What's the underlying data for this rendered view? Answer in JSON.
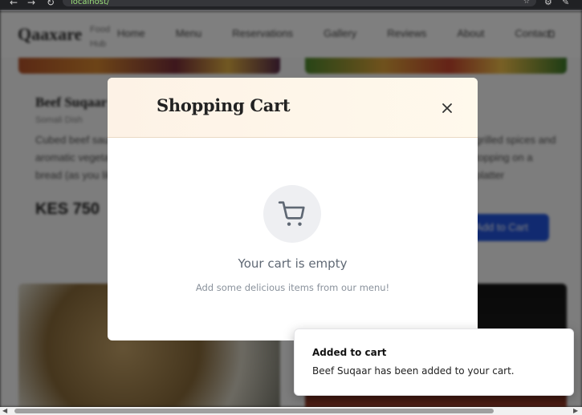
{
  "browser": {
    "url": "localhost/",
    "back_glyph": "←",
    "forward_glyph": "→",
    "reload_glyph": "↻",
    "star_glyph": "☆"
  },
  "site": {
    "logo": "Qaaxare",
    "logo_tagline": "Food Hub",
    "nav": [
      "Home",
      "Menu",
      "Reservations",
      "Gallery",
      "Reviews",
      "About",
      "Contact"
    ],
    "user_glyph": "Ŋ"
  },
  "background_card": {
    "title": "Beef Suqaar",
    "subtitle": "Somali Dish",
    "description_left": "Cubed beef sautéed with aromatic spices and aromatic vegetables, served with rice, pasta or bread (as you like)",
    "description_right": "grilled spices and topping on a platter",
    "price": "KES 750",
    "add_button": "Add to Cart"
  },
  "modal": {
    "title": "Shopping Cart",
    "empty_title": "Your cart is empty",
    "empty_subtitle": "Add some delicious items from our menu!"
  },
  "toast": {
    "title": "Added to cart",
    "message": "Beef Suqaar has been added to your cart."
  },
  "colors": {
    "modal_header_bg": "#fdf2e6",
    "accent_blue": "#2355e0",
    "empty_text": "#5f6874"
  }
}
